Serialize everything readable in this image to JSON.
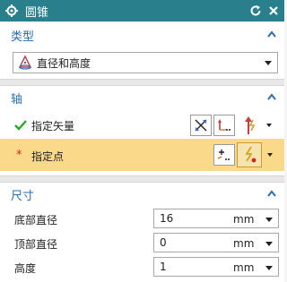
{
  "window": {
    "title": "圆锥"
  },
  "type_section": {
    "label": "类型",
    "selected": "直径和高度"
  },
  "axis_section": {
    "label": "轴",
    "vector_label": "指定矢量",
    "point_label": "指定点",
    "required_mark": "*"
  },
  "dimension_section": {
    "label": "尺寸",
    "rows": [
      {
        "label": "底部直径",
        "value": "16",
        "unit": "mm"
      },
      {
        "label": "顶部直径",
        "value": "0",
        "unit": "mm"
      },
      {
        "label": "高度",
        "value": "1",
        "unit": "mm"
      }
    ]
  },
  "colors": {
    "titlebar": "#2a7f8c",
    "section_label": "#2a6fb4",
    "highlight": "#fbd98b",
    "check": "#2aa82a",
    "required": "#e02020"
  }
}
